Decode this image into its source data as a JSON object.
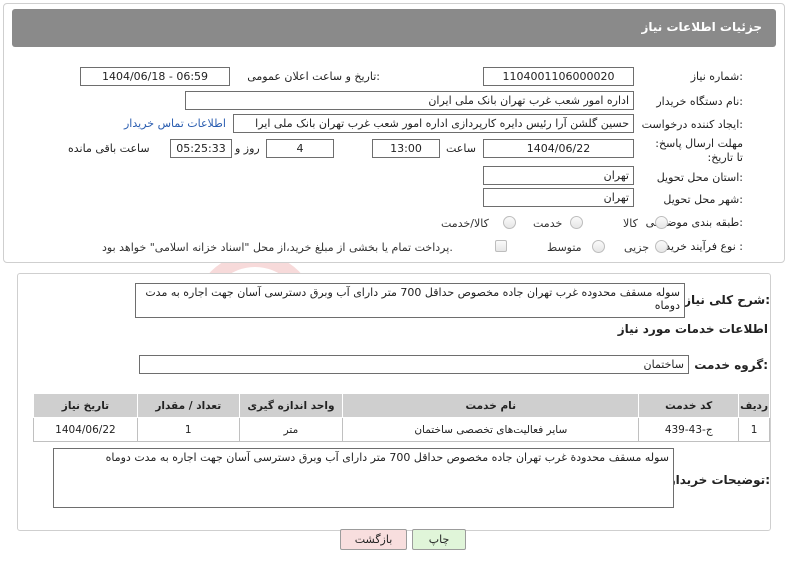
{
  "header": {
    "title": "جزئیات اطلاعات نیاز"
  },
  "form": {
    "need_number": {
      "label": "شماره نیاز:",
      "value": "1104001106000020"
    },
    "announce_datetime": {
      "label": "تاریخ و ساعت اعلان عمومی:",
      "value": "1404/06/18 - 06:59"
    },
    "buyer_org": {
      "label": "نام دستگاه خریدار:",
      "value": "اداره امور شعب غرب تهران بانک ملی ایران"
    },
    "requester": {
      "label": "ایجاد کننده درخواست:",
      "value": "حسین گلشن آرا رئیس دایره کارپردازی اداره امور شعب غرب تهران بانک ملی ایرا",
      "contact_link": "اطلاعات تماس خریدار"
    },
    "deadline": {
      "label": "مهلت ارسال پاسخ: تا تاریخ:",
      "date": "1404/06/22",
      "time_label": "ساعت",
      "time": "13:00",
      "days": "4",
      "days_label": "روز و",
      "remaining": "05:25:33",
      "remaining_label": "ساعت باقی مانده"
    },
    "province": {
      "label": "استان محل تحویل:",
      "value": "تهران"
    },
    "city": {
      "label": "شهر محل تحویل:",
      "value": "تهران"
    },
    "category": {
      "label": "طبقه بندی موضوعی:",
      "options": [
        "کالا",
        "خدمت",
        "کالا/خدمت"
      ]
    },
    "process": {
      "label": "نوع فرآیند خرید :",
      "options": [
        "جزیی",
        "متوسط"
      ],
      "payment_note": "پرداخت تمام یا بخشی از مبلغ خرید،از محل \"اسناد خزانه اسلامی\" خواهد بود."
    }
  },
  "need_summary": {
    "label": "شرح کلی نیاز:",
    "value": "سوله مسقف  محدوده غرب تهران   جاده مخصوص   حداقل 700 متر   دارای آب وبرق دسترسی آسان  جهت اجاره  به مدت دوماه"
  },
  "services": {
    "section_title": "اطلاعات خدمات مورد نیاز",
    "group_label": "گروه خدمت:",
    "group_value": "ساختمان",
    "table": {
      "columns": [
        "ردیف",
        "کد خدمت",
        "نام خدمت",
        "واحد اندازه گیری",
        "تعداد / مقدار",
        "تاریخ نیاز"
      ],
      "rows": [
        [
          "1",
          "ج-43-439",
          "سایر فعالیت‌های تخصصی ساختمان",
          "متر",
          "1",
          "1404/06/22"
        ]
      ]
    }
  },
  "buyer_notes": {
    "label": "توضیحات خریدار:",
    "value": "سوله مسقف  محدودة غرب تهران   جاده مخصوص   حداقل 700 متر   دارای آب وبرق دسترسی آسان  جهت اجاره  به مدت دوماه"
  },
  "buttons": {
    "print": "چاپ",
    "back": "بازگشت"
  },
  "colors": {
    "header_bg": "#8a8a8a",
    "link": "#2a5db0",
    "back_btn_bg": "#f8dede",
    "print_btn_bg": "#e0f5d9"
  }
}
